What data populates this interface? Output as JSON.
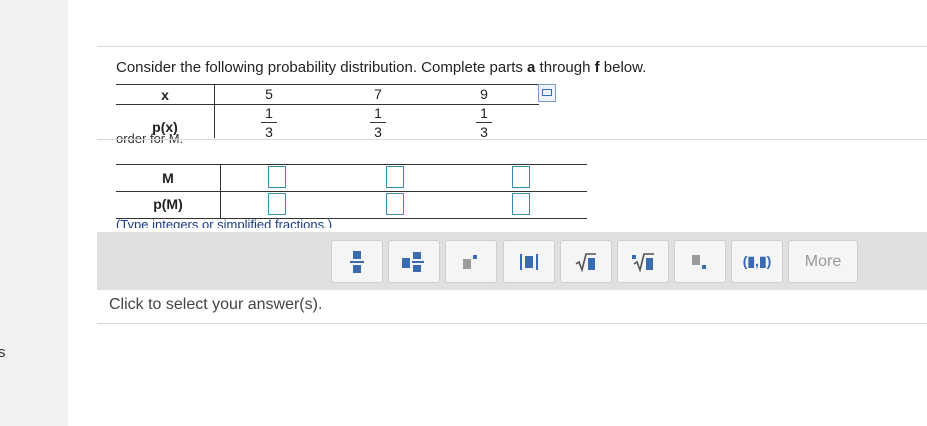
{
  "left_panel": {
    "fragment": "s"
  },
  "question": {
    "part1": "Consider the following probability distribution. Complete parts ",
    "bold_a": "a",
    "part2": " through ",
    "bold_f": "f",
    "part3": " below."
  },
  "distribution_table": {
    "x_label": "x",
    "px_label": "p(x)",
    "x_values": [
      "5",
      "7",
      "9"
    ],
    "p_numerators": [
      "1",
      "1",
      "1"
    ],
    "p_denominators": [
      "3",
      "3",
      "3"
    ]
  },
  "cut_text": "order for M.",
  "sampling_table": {
    "m_label": "M",
    "pm_label": "p(M)"
  },
  "hint": "(Type integers or simplified fractions.)",
  "toolbar": {
    "buttons": [
      "fraction",
      "mixed-number",
      "exponent",
      "absolute-value",
      "square-root",
      "nth-root",
      "subscript",
      "ordered-pair"
    ],
    "ordered_pair_label": "(▮,▮)",
    "more_label": "More"
  },
  "answer_prompt": "Click to select your answer(s).",
  "colors": {
    "accent": "#3a6ab0",
    "input_border": "#3a8fb8",
    "toolbar_bg": "#e0e0e0"
  }
}
